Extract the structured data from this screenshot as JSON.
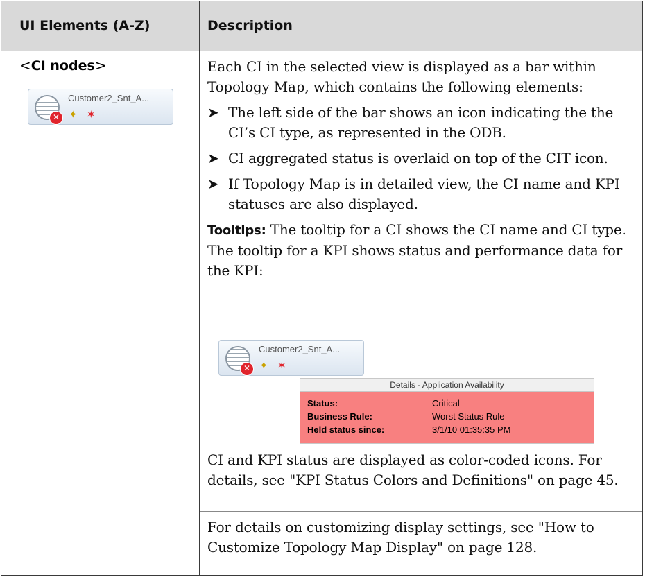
{
  "header": {
    "col1": "UI Elements (A-Z)",
    "col2": "Description"
  },
  "row": {
    "name_open": "<",
    "name": "CI nodes",
    "name_close": ">",
    "intro": "Each CI in the selected view is displayed as a bar within Topology Map, which contains the following elements:",
    "bullets": [
      "The left side of the bar shows an icon indicating the the CI’s CI type, as represented in the ODB.",
      "CI aggregated status is overlaid on top of the CIT icon.",
      "If Topology Map is in detailed view, the CI name and KPI statuses are also displayed."
    ],
    "tooltips_lead": "Tooltips:",
    "tooltips_text": " The tooltip for a CI shows the CI name and CI type. The tooltip for a KPI shows status and performance data for the KPI:",
    "colors_text": "CI and KPI status are displayed as color-coded icons. For details, see \"KPI Status Colors and Definitions\" on page 45.",
    "customize_text": "For details on customizing display settings, see \"How to Customize Topology Map Display\" on page 128."
  },
  "node": {
    "label": "Customer2_Snt_A...",
    "status_icon": "critical-x-icon",
    "ci_type_icon": "globe-icon"
  },
  "tooltip": {
    "title": "Details - Application Availability",
    "rows": [
      {
        "key": "Status:",
        "value": "Critical"
      },
      {
        "key": "Business Rule:",
        "value": "Worst Status Rule"
      },
      {
        "key": "Held status since:",
        "value": "3/1/10 01:35:35 PM"
      }
    ],
    "background": "#f88080"
  }
}
